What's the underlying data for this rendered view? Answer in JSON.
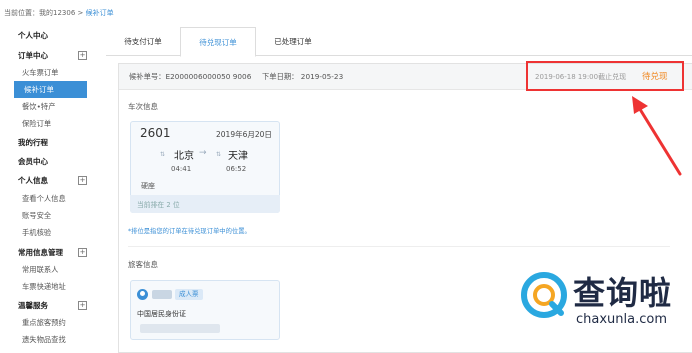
{
  "breadcrumb": {
    "prefix": "当前位置：我的12306 > ",
    "current": "候补订单"
  },
  "sidebar": {
    "items": [
      {
        "label": "个人中心",
        "type": "head"
      },
      {
        "label": "订单中心",
        "type": "head",
        "expand": "+"
      },
      {
        "label": "火车票订单",
        "type": "sub"
      },
      {
        "label": "候补订单",
        "type": "active"
      },
      {
        "label": "餐饮•特产",
        "type": "sub"
      },
      {
        "label": "保险订单",
        "type": "sub"
      },
      {
        "label": "我的行程",
        "type": "head"
      },
      {
        "label": "会员中心",
        "type": "head"
      },
      {
        "label": "个人信息",
        "type": "head",
        "expand": "+"
      },
      {
        "label": "查看个人信息",
        "type": "sub"
      },
      {
        "label": "账号安全",
        "type": "sub"
      },
      {
        "label": "手机核验",
        "type": "sub"
      },
      {
        "label": "常用信息管理",
        "type": "head",
        "expand": "+"
      },
      {
        "label": "常用联系人",
        "type": "sub"
      },
      {
        "label": "车票快递地址",
        "type": "sub"
      },
      {
        "label": "温馨服务",
        "type": "head",
        "expand": "+"
      },
      {
        "label": "重点旅客预约",
        "type": "sub"
      },
      {
        "label": "遗失物品查找",
        "type": "sub"
      }
    ]
  },
  "tabs": [
    {
      "label": "待支付订单"
    },
    {
      "label": "待兑现订单"
    },
    {
      "label": "已处理订单"
    }
  ],
  "order": {
    "order_no": "候补单号：E2000006000050 9006",
    "order_date": "下单日期： 2019-05-23",
    "deadline": "2019-06-18 19:00截止兑现",
    "status": "待兑现"
  },
  "train_section": {
    "title": "车次信息",
    "train_no": "2601",
    "date": "2019年6月20日",
    "from": "北京",
    "to": "天津",
    "depart_time": "04:41",
    "arrive_time": "06:52",
    "seat": "硬座",
    "queue": "当前排在 2 位",
    "note": "*排位是指您的订单在待兑现订单中的位置。"
  },
  "passenger_section": {
    "title": "旅客信息",
    "ticket_type": "成人票",
    "id_type": "中国居民身份证"
  },
  "watermark": {
    "title": "查询啦",
    "url": "chaxunla.com"
  },
  "colors": {
    "accent": "#3b8fd6",
    "status": "#f08a24",
    "highlight": "#e33333"
  }
}
